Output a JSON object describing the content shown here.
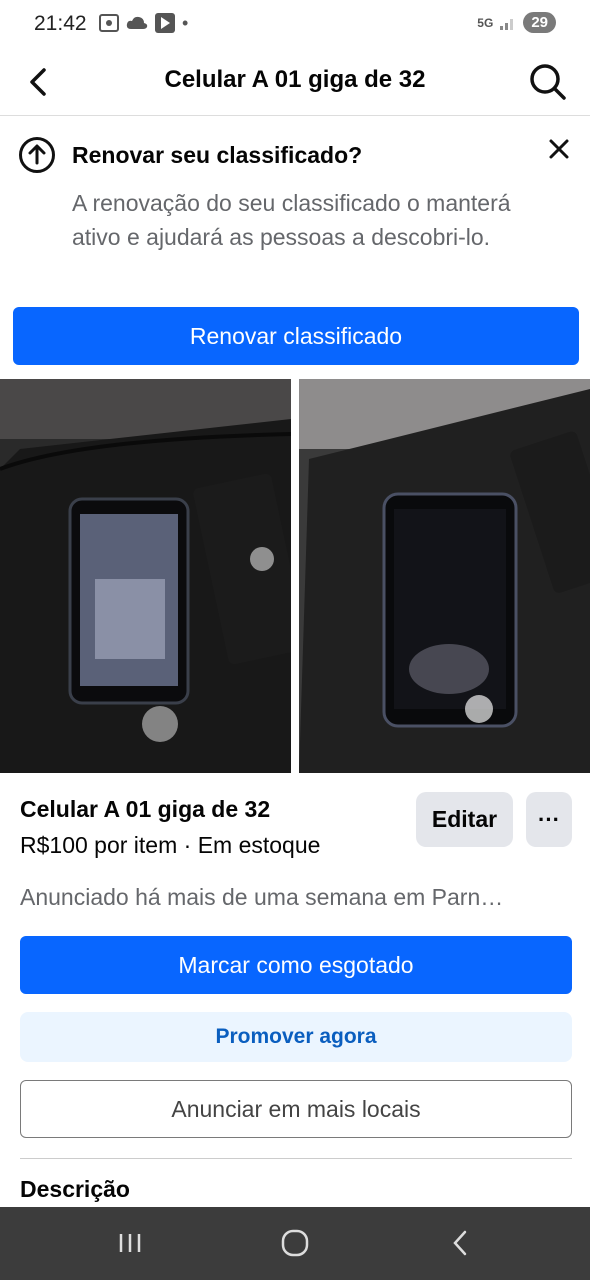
{
  "status_bar": {
    "time": "21:42",
    "network": "5G",
    "battery": "29",
    "dot": "•"
  },
  "header": {
    "title": "Celular A 01 giga de 32",
    "back_icon": "back-arrow-icon",
    "search_icon": "search-icon"
  },
  "renew_banner": {
    "title": "Renovar seu classificado?",
    "text": "A renovação do seu classificado o manterá ativo e ajudará as pessoas a descobri-lo.",
    "button_label": "Renovar classificado",
    "close_icon": "close-icon",
    "renew_icon": "arrow-up-circle-icon"
  },
  "listing": {
    "title": "Celular A 01 giga de 32",
    "price_line": "R$100 por item · Em estoque",
    "edit_label": "Editar",
    "more_label": "···",
    "posted": "Anunciado há mais de uma semana em Parn…"
  },
  "actions": {
    "mark_sold": "Marcar como esgotado",
    "promote": "Promover agora",
    "more_places": "Anunciar em mais locais"
  },
  "description": {
    "heading": "Descrição"
  },
  "colors": {
    "primary": "#0866ff",
    "promote_bg": "#ebf5ff",
    "promote_text": "#0a5ebf",
    "secondary_bg": "#e4e6eb",
    "muted_text": "#65676b"
  }
}
